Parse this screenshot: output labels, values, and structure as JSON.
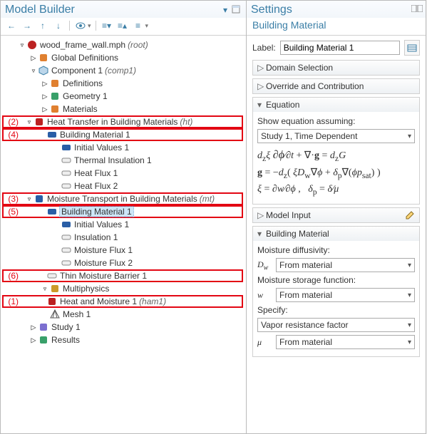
{
  "left": {
    "title": "Model Builder",
    "toolbar_icons": [
      "arrow-left",
      "arrow-right",
      "arrow-up",
      "arrow-down",
      "show",
      "expand",
      "collapse",
      "tree-toggle"
    ],
    "tree": [
      {
        "indent": 22,
        "exp": "▿",
        "icon": "root",
        "label": "wood_frame_wall.mph",
        "suffix": "(root)",
        "di": true
      },
      {
        "indent": 38,
        "exp": "▷",
        "icon": "globe",
        "label": "Global Definitions",
        "di": true
      },
      {
        "indent": 38,
        "exp": "▿",
        "icon": "comp",
        "label": "Component 1",
        "suffix": "(comp1)",
        "di": true
      },
      {
        "indent": 54,
        "exp": "▷",
        "icon": "defs",
        "label": "Definitions",
        "di": true
      },
      {
        "indent": 54,
        "exp": "▷",
        "icon": "geom",
        "label": "Geometry 1",
        "di": true
      },
      {
        "indent": 54,
        "exp": "▷",
        "icon": "mats",
        "label": "Materials",
        "di": true
      },
      {
        "indent": 30,
        "exp": "▿",
        "icon": "ht",
        "label": "Heat Transfer in Building Materials",
        "suffix": "(ht)",
        "box": true,
        "annot": "(2)",
        "di": true
      },
      {
        "indent": 48,
        "exp": "",
        "icon": "bm",
        "label": "Building Material 1",
        "box": true,
        "annot": "(4)",
        "di": true
      },
      {
        "indent": 70,
        "exp": "",
        "icon": "bm",
        "label": "Initial Values 1",
        "di": true
      },
      {
        "indent": 70,
        "exp": "",
        "icon": "bc",
        "label": "Thermal Insulation 1",
        "di": true
      },
      {
        "indent": 70,
        "exp": "",
        "icon": "bc",
        "label": "Heat Flux 1",
        "di": true
      },
      {
        "indent": 70,
        "exp": "",
        "icon": "bc",
        "label": "Heat Flux 2",
        "di": true
      },
      {
        "indent": 30,
        "exp": "▿",
        "icon": "mt",
        "label": "Moisture Transport in Building Materials",
        "suffix": "(mt)",
        "box": true,
        "annot": "(3)",
        "di": true
      },
      {
        "indent": 48,
        "exp": "",
        "icon": "mtb",
        "label": "Building Material 1",
        "box": true,
        "annot": "(5)",
        "sel": true,
        "di": true
      },
      {
        "indent": 70,
        "exp": "",
        "icon": "mtb",
        "label": "Initial Values 1",
        "di": true
      },
      {
        "indent": 70,
        "exp": "",
        "icon": "bc",
        "label": "Insulation 1",
        "di": true
      },
      {
        "indent": 70,
        "exp": "",
        "icon": "bc",
        "label": "Moisture Flux 1",
        "di": true
      },
      {
        "indent": 70,
        "exp": "",
        "icon": "bc",
        "label": "Moisture Flux 2",
        "di": true
      },
      {
        "indent": 48,
        "exp": "",
        "icon": "bc",
        "label": "Thin Moisture Barrier 1",
        "box": true,
        "annot": "(6)",
        "di": true
      },
      {
        "indent": 54,
        "exp": "▿",
        "icon": "mphys",
        "label": "Multiphysics",
        "di": true
      },
      {
        "indent": 48,
        "exp": "",
        "icon": "ham",
        "label": "Heat and Moisture 1",
        "suffix": "(ham1)",
        "box": true,
        "annot": "(1)",
        "di": true
      },
      {
        "indent": 54,
        "exp": "",
        "icon": "mesh",
        "label": "Mesh 1",
        "di": true
      },
      {
        "indent": 38,
        "exp": "▷",
        "icon": "study",
        "label": "Study 1",
        "di": true
      },
      {
        "indent": 38,
        "exp": "▷",
        "icon": "results",
        "label": "Results",
        "di": true
      }
    ]
  },
  "right": {
    "title": "Settings",
    "subtitle": "Building Material",
    "label_caption": "Label:",
    "label_value": "Building Material 1",
    "sections": {
      "domain": "Domain Selection",
      "override": "Override and Contribution",
      "equation": "Equation",
      "model_input": "Model Input",
      "building_material": "Building Material"
    },
    "equation": {
      "assume_caption": "Show equation assuming:",
      "study_value": "Study 1, Time Dependent",
      "line1": "d_z ξ (∂ϕ/∂t) + ∇·g = d_z G",
      "line2": "g = - d_z ( ξ D_w ∇ϕ + δ_p ∇(ϕ p_sat) )",
      "line3": "ξ = ∂w/∂ϕ ,  δ_p = δ/μ"
    },
    "building_material": {
      "moist_diff_caption": "Moisture diffusivity:",
      "dw_sym": "D_w",
      "moist_stor_caption": "Moisture storage function:",
      "w_sym": "w",
      "specify_caption": "Specify:",
      "specify_value": "Vapor resistance factor",
      "mu_sym": "μ",
      "from_material": "From material"
    }
  }
}
